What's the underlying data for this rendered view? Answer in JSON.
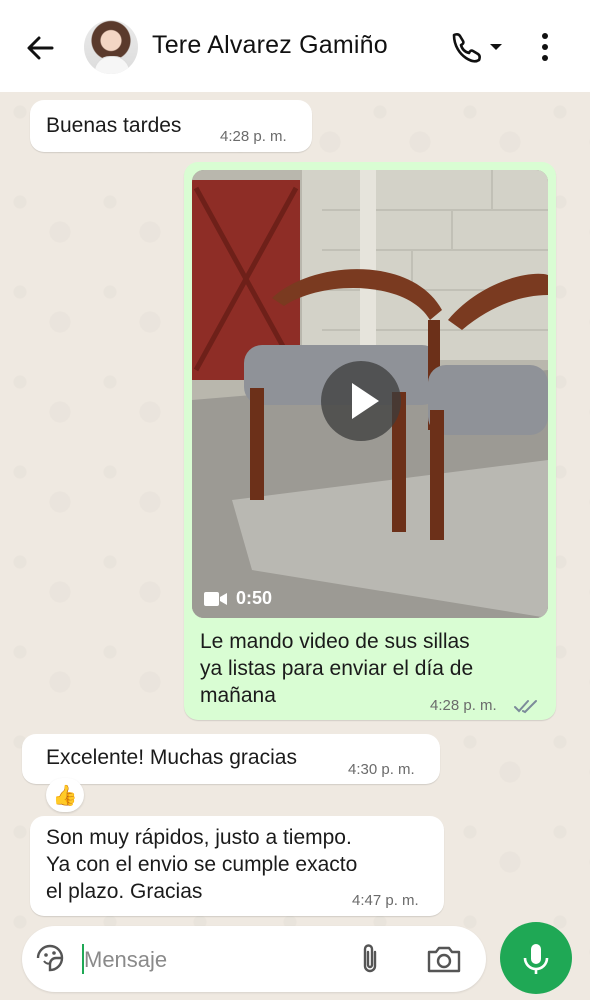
{
  "header": {
    "contact_name": "Tere Alvarez Gamiño"
  },
  "messages": [
    {
      "type": "incoming",
      "text": "Buenas tardes",
      "time": "4:28 p. m."
    },
    {
      "type": "outgoing_video",
      "duration": "0:50",
      "caption": "Le mando video de sus sillas\nya listas para enviar el día de\nmañana",
      "time": "4:28 p. m.",
      "status": "read"
    },
    {
      "type": "incoming",
      "text": "Excelente! Muchas gracias",
      "time": "4:30 p. m.",
      "reaction": "👍"
    },
    {
      "type": "incoming",
      "text": "Son muy rápidos, justo a tiempo.\nYa con el envio se cumple exacto\nel plazo. Gracias",
      "time": "4:47 p. m."
    }
  ],
  "composer": {
    "placeholder": "Mensaje"
  },
  "icons": {
    "back": "arrow-left-icon",
    "call": "phone-icon",
    "menu": "more-vertical-icon",
    "sticker": "sticker-icon",
    "attach": "paperclip-icon",
    "camera": "camera-icon",
    "mic": "microphone-icon"
  },
  "colors": {
    "outgoing_bubble": "#d9fdd3",
    "accent": "#1fa855",
    "read_ticks": "#7c8b9a"
  }
}
